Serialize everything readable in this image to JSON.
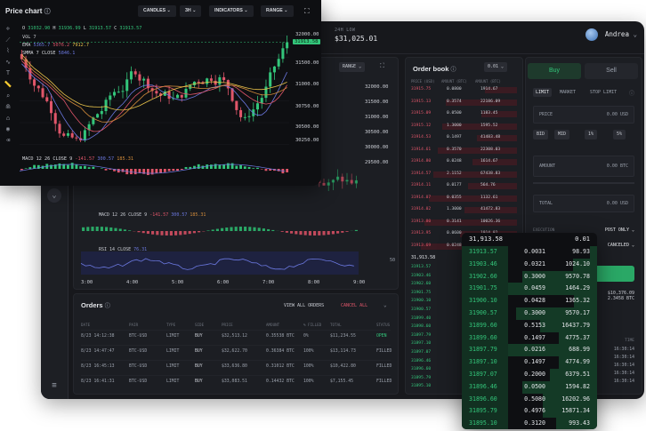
{
  "sidebar": {
    "collapse_icon": "chevron-down-icon",
    "menu_icon": "menu-icon"
  },
  "topbar": {
    "low_label": "24H LOW",
    "low_value": "$31,025.01",
    "user_name": "Andrea"
  },
  "chart_panel_back": {
    "range_label": "RANGE",
    "price_axis": [
      "32000.00",
      "31500.00",
      "31000.00",
      "30500.00",
      "30000.00",
      "29500.00"
    ],
    "last_price": "31913.58",
    "macd_label": "MACD 12 26 CLOSE 9",
    "macd_values": [
      "-141.57",
      "300.57",
      "185.31"
    ],
    "rsi_label": "RSI 14 CLOSE",
    "rsi_value": "76.31",
    "rsi_scale": "50",
    "time_axis": [
      "3:00",
      "4:00",
      "5:00",
      "6:00",
      "7:00",
      "8:00",
      "9:00"
    ]
  },
  "orders": {
    "title": "Orders",
    "view_all": "VIEW ALL ORDERS",
    "cancel_all": "CANCEL ALL",
    "columns": [
      "DATE",
      "PAIR",
      "TYPE",
      "SIDE",
      "PRICE",
      "AMOUNT",
      "% FILLED",
      "TOTAL",
      "STATUS"
    ],
    "rows": [
      {
        "date": "8/23 14:12:38",
        "pair": "BTC-USD",
        "type": "LIMIT",
        "side": "BUY",
        "price": "$32,513.12",
        "amount": "0.35538 BTC",
        "filled": "0%",
        "total": "$11,234.55",
        "status": "OPEN"
      },
      {
        "date": "8/23 14:47:47",
        "pair": "BTC-USD",
        "type": "LIMIT",
        "side": "BUY",
        "price": "$32,622.70",
        "amount": "0.36384 BTC",
        "filled": "100%",
        "total": "$13,114.73",
        "status": "FILLED"
      },
      {
        "date": "8/23 16:45:13",
        "pair": "BTC-USD",
        "type": "LIMIT",
        "side": "BUY",
        "price": "$33,636.80",
        "amount": "0.31012 BTC",
        "filled": "100%",
        "total": "$10,422.80",
        "status": "FILLED"
      },
      {
        "date": "8/23 16:41:31",
        "pair": "BTC-USD",
        "type": "LIMIT",
        "side": "BUY",
        "price": "$33,083.51",
        "amount": "0.14432 BTC",
        "filled": "100%",
        "total": "$7,155.45",
        "status": "FILLED"
      }
    ]
  },
  "orderbook_back": {
    "title": "Order book",
    "precision": "0.01",
    "columns": [
      "PRICE (USD)",
      "AMOUNT (BTC)",
      "AMOUNT (BTC)"
    ],
    "asks": [
      [
        "31915.75",
        "0.0800",
        "1914.67"
      ],
      [
        "31915.13",
        "0.3574",
        "22186.09"
      ],
      [
        "31915.09",
        "0.0500",
        "1183.45"
      ],
      [
        "31915.12",
        "1.3000",
        "1595.52"
      ],
      [
        "31914.53",
        "0.1497",
        "41483.48"
      ],
      [
        "31914.61",
        "0.3570",
        "22308.03"
      ],
      [
        "31914.80",
        "0.0248",
        "1614.67"
      ],
      [
        "31914.57",
        "2.1152",
        "67438.83"
      ],
      [
        "31914.11",
        "0.0177",
        "564.76"
      ],
      [
        "31914.07",
        "0.0355",
        "1132.61"
      ],
      [
        "31914.02",
        "1.3000",
        "41472.83"
      ],
      [
        "31913.80",
        "0.3141",
        "10026.36"
      ],
      [
        "31913.95",
        "0.0600",
        "1914.82"
      ],
      [
        "31913.69",
        "0.0248",
        "791.50"
      ]
    ],
    "mid": "31,913.58",
    "bids_prices": [
      "31913.57",
      "31903.46",
      "31902.60",
      "31901.75",
      "31900.10",
      "31900.57",
      "31899.40",
      "31898.60",
      "31897.79",
      "31897.10",
      "31897.07",
      "31896.46",
      "31896.60",
      "31895.79",
      "31895.10"
    ]
  },
  "trade_panel": {
    "buy_tab": "Buy",
    "sell_tab": "Sell",
    "order_types": [
      "LIMIT",
      "MARKET",
      "STOP LIMIT"
    ],
    "price_label": "PRICE",
    "price_value": "0.00 USD",
    "quick_buttons": [
      "BID",
      "MID",
      "1%",
      "5%"
    ],
    "amount_label": "AMOUNT",
    "amount_value": "0.00 BTC",
    "total_label": "TOTAL",
    "total_value": "0.00 USD",
    "execution_label": "EXECUTION",
    "execution_value": "POST ONLY",
    "tif_value": "CANCELED",
    "balance_usd": "$10,376.09",
    "balance_btc": "2.3458 BTC",
    "trades_time_col": "TIME",
    "trade_times": [
      "16:30:14",
      "16:30:14",
      "16:30:14",
      "16:30:14",
      "16:30:14"
    ]
  },
  "price_chart": {
    "title": "Price chart",
    "candles_label": "CANDLES",
    "interval_label": "3H",
    "indicators_label": "INDICATORS",
    "range_label": "RANGE",
    "ohlc": {
      "o_label": "O",
      "o": "31032.90",
      "h_label": "H",
      "h": "31936.99",
      "l_label": "L",
      "l": "31913.57",
      "c_label": "C",
      "c": "31913.57"
    },
    "vol_label": "VOL 7",
    "ema_label": "EMA",
    "ema_values": [
      "5365.7",
      "5076.2",
      "7912.7"
    ],
    "smma_label": "SMMA 7 CLOSE",
    "smma_value": "5846.1",
    "price_axis": [
      "32000.00",
      "31500.00",
      "31000.00",
      "30750.00",
      "30500.00",
      "30250.00"
    ],
    "last_price": "31913.58",
    "macd_label": "MACD 12 26 CLOSE 9",
    "macd_values": [
      "-141.57",
      "300.57",
      "185.31"
    ],
    "colors": {
      "up": "#33c57a",
      "down": "#e0566a",
      "ema1": "#e0566a",
      "ema2": "#d08a3a",
      "ema3": "#e8c24a",
      "smma": "#6b78e0"
    }
  },
  "float_orderbook": {
    "mid_price": "31,913.58",
    "mid_amount": "0.01",
    "rows": [
      {
        "price": "31913.57",
        "amount": "0.0031",
        "total": "98.93",
        "fill": 0.05
      },
      {
        "price": "31903.46",
        "amount": "0.0321",
        "total": "1024.10",
        "fill": 0.18
      },
      {
        "price": "31902.60",
        "amount": "0.3000",
        "total": "9570.78",
        "fill": 0.55
      },
      {
        "price": "31901.75",
        "amount": "0.0459",
        "total": "1464.29",
        "fill": 0.9
      },
      {
        "price": "31900.10",
        "amount": "0.0428",
        "total": "1365.32",
        "fill": 0.17
      },
      {
        "price": "31900.57",
        "amount": "0.3000",
        "total": "9570.17",
        "fill": 0.6
      },
      {
        "price": "31899.60",
        "amount": "0.5153",
        "total": "16437.79",
        "fill": 0.42
      },
      {
        "price": "31899.60",
        "amount": "0.1497",
        "total": "4775.37",
        "fill": 0.28
      },
      {
        "price": "31897.79",
        "amount": "0.0216",
        "total": "688.99",
        "fill": 0.92
      },
      {
        "price": "31897.10",
        "amount": "0.1497",
        "total": "4774.99",
        "fill": 0.28
      },
      {
        "price": "31897.07",
        "amount": "0.2000",
        "total": "6379.51",
        "fill": 0.35
      },
      {
        "price": "31896.46",
        "amount": "0.0500",
        "total": "1594.82",
        "fill": 0.55
      },
      {
        "price": "31896.60",
        "amount": "0.5080",
        "total": "16202.96",
        "fill": 0.4
      },
      {
        "price": "31895.79",
        "amount": "0.4976",
        "total": "15871.34",
        "fill": 0.4
      },
      {
        "price": "31895.10",
        "amount": "0.3120",
        "total": "993.43",
        "fill": 0.3
      }
    ]
  }
}
